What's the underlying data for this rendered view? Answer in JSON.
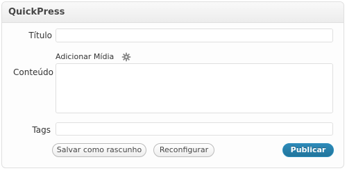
{
  "widget": {
    "title": "QuickPress"
  },
  "form": {
    "title_label": "Título",
    "title_value": "",
    "media_label": "Adicionar Mídia",
    "content_label": "Conteúdo",
    "content_value": "",
    "tags_label": "Tags",
    "tags_value": ""
  },
  "actions": {
    "save_draft_label": "Salvar como rascunho",
    "reset_label": "Reconfigurar",
    "publish_label": "Publicar"
  },
  "colors": {
    "primary": "#21759b",
    "border": "#dfdfdf"
  },
  "icons": {
    "media": "media-gear-icon"
  }
}
